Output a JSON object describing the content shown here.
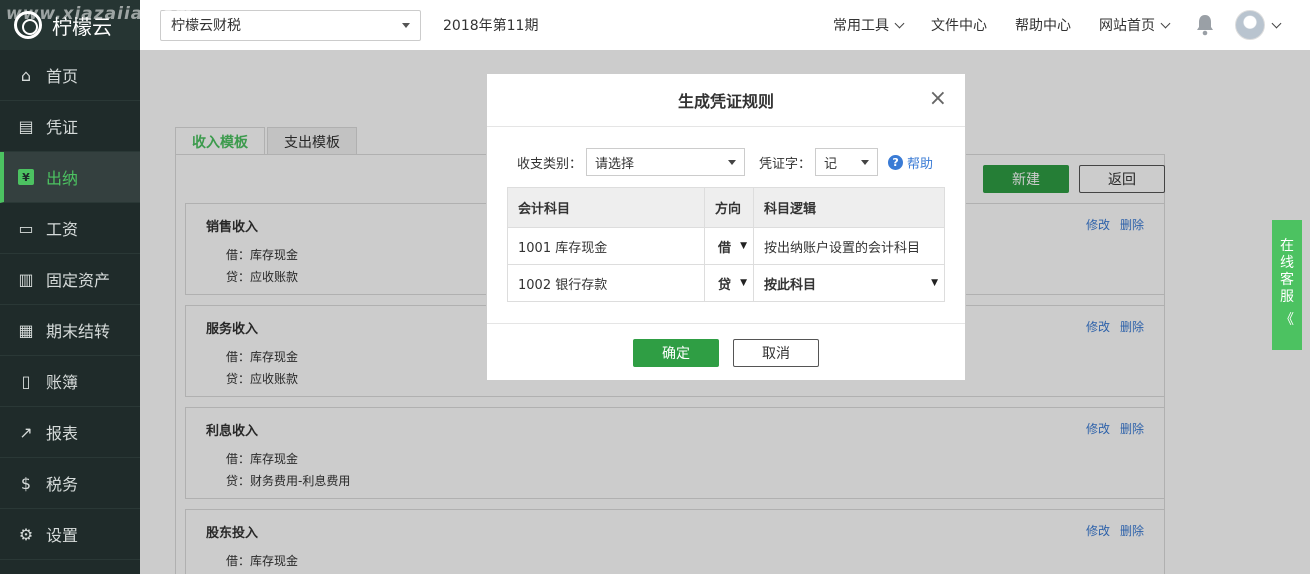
{
  "watermark": "www.xiazaiia.com",
  "brand": {
    "name": "柠檬云"
  },
  "nav": [
    {
      "label": "首页",
      "icon": "home-icon",
      "glyph": "⌂"
    },
    {
      "label": "凭证",
      "icon": "voucher-icon",
      "glyph": "▤"
    },
    {
      "label": "出纳",
      "icon": "cashier-icon",
      "glyph": "¥",
      "active": true
    },
    {
      "label": "工资",
      "icon": "salary-icon",
      "glyph": "▭"
    },
    {
      "label": "固定资产",
      "icon": "asset-icon",
      "glyph": "▥"
    },
    {
      "label": "期末结转",
      "icon": "calendar-icon",
      "glyph": "▦"
    },
    {
      "label": "账簿",
      "icon": "ledger-icon",
      "glyph": "▯"
    },
    {
      "label": "报表",
      "icon": "chart-icon",
      "glyph": "↗"
    },
    {
      "label": "税务",
      "icon": "tax-icon",
      "glyph": "$"
    },
    {
      "label": "设置",
      "icon": "settings-icon",
      "glyph": "⚙"
    }
  ],
  "topbar": {
    "company": "柠檬云财税",
    "period": "2018年第11期",
    "links": [
      "常用工具",
      "文件中心",
      "帮助中心",
      "网站首页"
    ]
  },
  "tabs": [
    "收入模板",
    "支出模板"
  ],
  "actions": {
    "new": "新建",
    "back": "返回"
  },
  "cards": [
    {
      "title": "销售收入",
      "debit": "借：库存现金",
      "credit": "贷：应收账款"
    },
    {
      "title": "服务收入",
      "debit": "借：库存现金",
      "credit": "贷：应收账款"
    },
    {
      "title": "利息收入",
      "debit": "借：库存现金",
      "credit": "贷：财务费用-利息费用"
    },
    {
      "title": "股东投入",
      "debit": "借：库存现金",
      "credit": ""
    }
  ],
  "card_actions": {
    "edit": "修改",
    "delete": "删除"
  },
  "service": [
    "在",
    "线",
    "客",
    "服",
    "《"
  ],
  "modal": {
    "title": "生成凭证规则",
    "close": "×",
    "type_label": "收支类别：",
    "type_value": "请选择",
    "word_label": "凭证字：",
    "word_value": "记",
    "help": "帮助",
    "columns": [
      "会计科目",
      "方向",
      "科目逻辑"
    ],
    "rows": [
      {
        "account": "1001 库存现金",
        "direction": "借",
        "logic": "按出纳账户设置的会计科目",
        "logic_select": false
      },
      {
        "account": "1002 银行存款",
        "direction": "贷",
        "logic": "按此科目",
        "logic_select": true
      }
    ],
    "ok": "确定",
    "cancel": "取消"
  },
  "colors": {
    "accent": "#4cc261",
    "button_green": "#2f9e44",
    "link": "#3a7bd5",
    "sidebar": "#1f2b2a"
  }
}
